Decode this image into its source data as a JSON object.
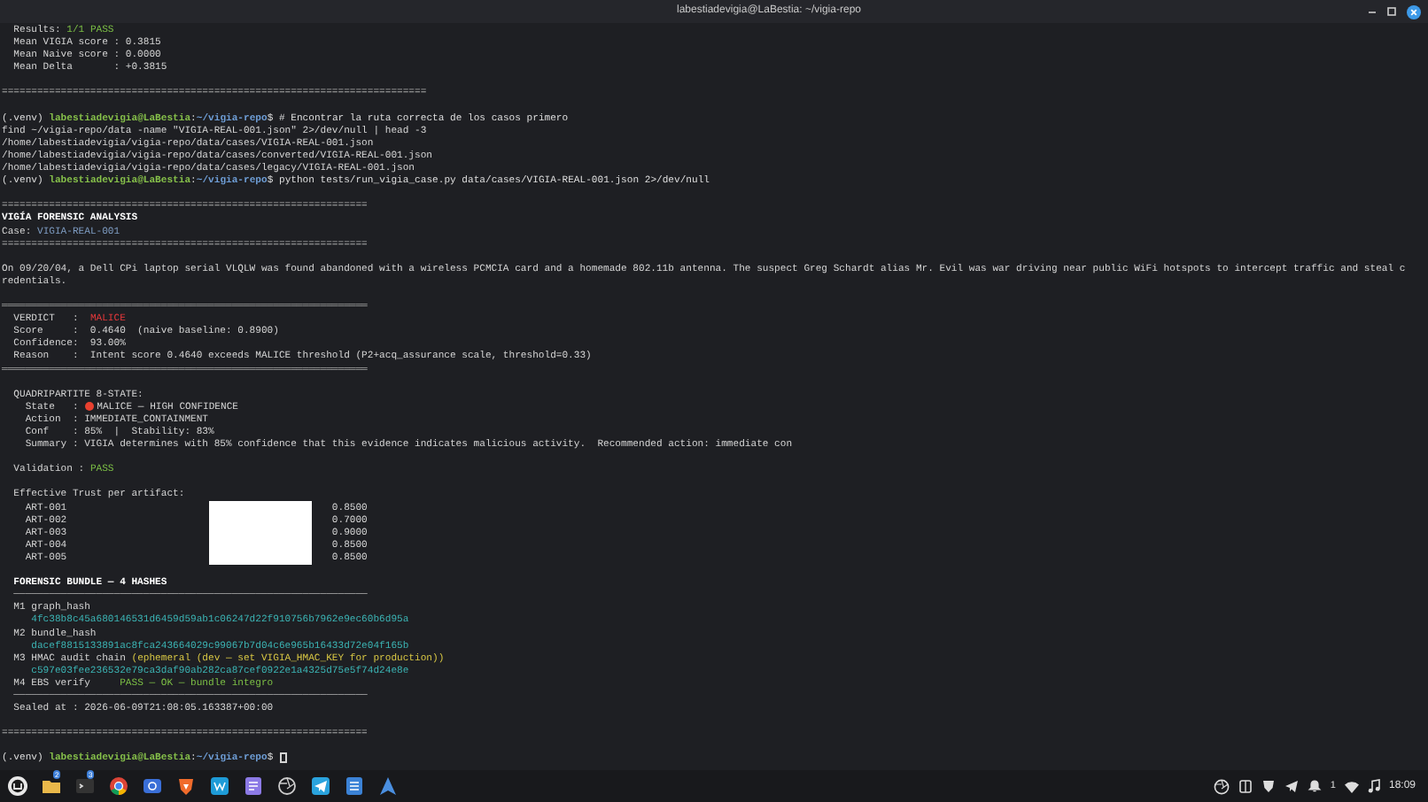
{
  "window": {
    "title": "labestiadevigia@LaBestia: ~/vigia-repo"
  },
  "terminal": {
    "lines": [
      {
        "kind": "output",
        "segments": [
          {
            "kind": "plain",
            "text": "  Results: "
          },
          {
            "kind": "pass",
            "text": "1/1 PASS"
          }
        ]
      },
      {
        "kind": "output",
        "segments": [
          {
            "kind": "plain",
            "text": "  Mean VIGIA score : 0.3815"
          }
        ]
      },
      {
        "kind": "output",
        "segments": [
          {
            "kind": "plain",
            "text": "  Mean Naive score : 0.0000"
          }
        ]
      },
      {
        "kind": "output",
        "segments": [
          {
            "kind": "plain",
            "text": "  Mean Delta       : +0.3815"
          }
        ]
      },
      {
        "kind": "rule",
        "space_before": true,
        "segments": [
          {
            "kind": "plain",
            "text": "========================================================================"
          }
        ]
      },
      {
        "kind": "prompt",
        "space_before": true,
        "segments": [
          {
            "kind": "plain",
            "text": "(.venv) "
          },
          {
            "kind": "user",
            "text": "labestiadevigia@LaBestia"
          },
          {
            "kind": "plain",
            "text": ":"
          },
          {
            "kind": "path",
            "text": "~/vigia-repo"
          },
          {
            "kind": "plain",
            "text": "$ # Encontrar la ruta correcta de los casos primero"
          }
        ]
      },
      {
        "kind": "output",
        "segments": [
          {
            "kind": "plain",
            "text": "find ~/vigia-repo/data -name \"VIGIA-REAL-001.json\" 2>/dev/null | head -3"
          }
        ]
      },
      {
        "kind": "output",
        "segments": [
          {
            "kind": "plain",
            "text": "/home/labestiadevigia/vigia-repo/data/cases/VIGIA-REAL-001.json"
          }
        ]
      },
      {
        "kind": "output",
        "segments": [
          {
            "kind": "plain",
            "text": "/home/labestiadevigia/vigia-repo/data/cases/converted/VIGIA-REAL-001.json"
          }
        ]
      },
      {
        "kind": "output",
        "segments": [
          {
            "kind": "plain",
            "text": "/home/labestiadevigia/vigia-repo/data/cases/legacy/VIGIA-REAL-001.json"
          }
        ]
      },
      {
        "kind": "prompt",
        "segments": [
          {
            "kind": "plain",
            "text": "(.venv) "
          },
          {
            "kind": "user",
            "text": "labestiadevigia@LaBestia"
          },
          {
            "kind": "plain",
            "text": ":"
          },
          {
            "kind": "path",
            "text": "~/vigia-repo"
          },
          {
            "kind": "plain",
            "text": "$ python tests/run_vigia_case.py data/cases/VIGIA-REAL-001.json 2>/dev/null"
          }
        ]
      },
      {
        "kind": "rule",
        "space_before": true,
        "segments": [
          {
            "kind": "plain",
            "text": "=============================================================="
          }
        ]
      },
      {
        "kind": "heading",
        "segments": [
          {
            "kind": "head",
            "text": "VIGÍA FORENSIC ANALYSIS"
          }
        ]
      },
      {
        "kind": "output",
        "segments": [
          {
            "kind": "plain",
            "text": "Case: "
          },
          {
            "kind": "case",
            "text": "VIGIA-REAL-001"
          }
        ]
      },
      {
        "kind": "rule",
        "segments": [
          {
            "kind": "plain",
            "text": "=============================================================="
          }
        ]
      },
      {
        "kind": "output",
        "space_before": true,
        "segments": [
          {
            "kind": "plain",
            "text": "On 09/20/04, a Dell CPi laptop serial VLQLW was found abandoned with a wireless PCMCIA card and a homemade 802.11b antenna. The suspect Greg Schardt alias Mr. Evil was war driving near public WiFi hotspots to intercept traffic and steal c"
          }
        ]
      },
      {
        "kind": "output",
        "segments": [
          {
            "kind": "plain",
            "text": "redentials."
          }
        ]
      },
      {
        "kind": "rule",
        "space_before": true,
        "segments": [
          {
            "kind": "plain",
            "text": "══════════════════════════════════════════════════════════════"
          }
        ]
      },
      {
        "kind": "output",
        "segments": [
          {
            "kind": "plain",
            "text": "  VERDICT   :  "
          },
          {
            "kind": "alert",
            "text": "MALICE"
          }
        ]
      },
      {
        "kind": "output",
        "segments": [
          {
            "kind": "plain",
            "text": "  Score     :  0.4640  (naive baseline: 0.8900)"
          }
        ]
      },
      {
        "kind": "output",
        "segments": [
          {
            "kind": "plain",
            "text": "  Confidence:  93.00%"
          }
        ]
      },
      {
        "kind": "output",
        "segments": [
          {
            "kind": "plain",
            "text": "  Reason    :  Intent score 0.4640 exceeds MALICE threshold (P2+acq_assurance scale, threshold=0.33)"
          }
        ]
      },
      {
        "kind": "rule",
        "segments": [
          {
            "kind": "plain",
            "text": "══════════════════════════════════════════════════════════════"
          }
        ]
      },
      {
        "kind": "output",
        "space_before": true,
        "segments": [
          {
            "kind": "plain",
            "text": "  QUADRIPARTITE 8-STATE:"
          }
        ]
      },
      {
        "kind": "output",
        "segments": [
          {
            "kind": "plain",
            "text": "    State   : "
          },
          {
            "kind": "dot"
          },
          {
            "kind": "plain",
            "text": "MALICE — HIGH CONFIDENCE"
          }
        ]
      },
      {
        "kind": "output",
        "segments": [
          {
            "kind": "plain",
            "text": "    Action  : IMMEDIATE_CONTAINMENT"
          }
        ]
      },
      {
        "kind": "output",
        "segments": [
          {
            "kind": "plain",
            "text": "    Conf    : 85%  |  Stability: 83%"
          }
        ]
      },
      {
        "kind": "output",
        "segments": [
          {
            "kind": "plain",
            "text": "    Summary : VIGIA determines with 85% confidence that this evidence indicates malicious activity.  Recommended action: immediate con"
          }
        ]
      },
      {
        "kind": "output",
        "space_before": true,
        "segments": [
          {
            "kind": "plain",
            "text": "  Validation : "
          },
          {
            "kind": "pass",
            "text": "PASS"
          }
        ]
      },
      {
        "kind": "output",
        "space_before": true,
        "segments": [
          {
            "kind": "plain",
            "text": "  Effective Trust per artifact:"
          }
        ]
      },
      {
        "kind": "output",
        "segments": [
          {
            "kind": "plain",
            "text": "    ART-001                                             0.8500"
          }
        ]
      },
      {
        "kind": "output",
        "segments": [
          {
            "kind": "plain",
            "text": "    ART-002                                             0.7000"
          }
        ]
      },
      {
        "kind": "output",
        "segments": [
          {
            "kind": "plain",
            "text": "    ART-003                                             0.9000"
          }
        ]
      },
      {
        "kind": "output",
        "segments": [
          {
            "kind": "plain",
            "text": "    ART-004                                             0.8500"
          }
        ]
      },
      {
        "kind": "output",
        "segments": [
          {
            "kind": "plain",
            "text": "    ART-005                                             0.8500"
          }
        ]
      },
      {
        "kind": "heading",
        "space_before": true,
        "segments": [
          {
            "kind": "head",
            "text": "  FORENSIC BUNDLE — 4 HASHES"
          }
        ]
      },
      {
        "kind": "rule",
        "segments": [
          {
            "kind": "plain",
            "text": "  ────────────────────────────────────────────────────────────"
          }
        ]
      },
      {
        "kind": "output",
        "segments": [
          {
            "kind": "plain",
            "text": "  M1 graph_hash"
          }
        ]
      },
      {
        "kind": "output",
        "segments": [
          {
            "kind": "hash",
            "text": "     4fc38b8c45a680146531d6459d59ab1c06247d22f910756b7962e9ec60b6d95a"
          }
        ]
      },
      {
        "kind": "output",
        "segments": [
          {
            "kind": "plain",
            "text": "  M2 bundle_hash"
          }
        ]
      },
      {
        "kind": "output",
        "segments": [
          {
            "kind": "hash",
            "text": "     dacef8815133891ac8fca243664029c99067b7d04c6e965b16433d72e04f165b"
          }
        ]
      },
      {
        "kind": "output",
        "segments": [
          {
            "kind": "plain",
            "text": "  M3 HMAC audit chain "
          },
          {
            "kind": "warn",
            "text": "(ephemeral (dev — set VIGIA_HMAC_KEY for production))"
          }
        ]
      },
      {
        "kind": "output",
        "segments": [
          {
            "kind": "hash",
            "text": "     c597e03fee236532e79ca3daf90ab282ca87cef0922e1a4325d75e5f74d24e8e"
          }
        ]
      },
      {
        "kind": "output",
        "segments": [
          {
            "kind": "plain",
            "text": "  M4 EBS verify     "
          },
          {
            "kind": "pass",
            "text": "PASS — OK — bundle integro"
          }
        ]
      },
      {
        "kind": "rule",
        "segments": [
          {
            "kind": "plain",
            "text": "  ────────────────────────────────────────────────────────────"
          }
        ]
      },
      {
        "kind": "output",
        "segments": [
          {
            "kind": "plain",
            "text": "  Sealed at : 2026-06-09T21:08:05.163387+00:00"
          }
        ]
      },
      {
        "kind": "rule",
        "space_before": true,
        "segments": [
          {
            "kind": "plain",
            "text": "=============================================================="
          }
        ]
      },
      {
        "kind": "prompt",
        "space_before": true,
        "cursor": true,
        "segments": [
          {
            "kind": "plain",
            "text": "(.venv) "
          },
          {
            "kind": "user",
            "text": "labestiadevigia@LaBestia"
          },
          {
            "kind": "plain",
            "text": ":"
          },
          {
            "kind": "path",
            "text": "~/vigia-repo"
          },
          {
            "kind": "plain",
            "text": "$ "
          }
        ]
      }
    ]
  },
  "taskbar": {
    "apps": [
      {
        "kind": "menu"
      },
      {
        "kind": "files",
        "badge": "2"
      },
      {
        "kind": "terminal",
        "badge": "3"
      },
      {
        "kind": "browser"
      },
      {
        "kind": "camera"
      },
      {
        "kind": "lion"
      },
      {
        "kind": "editor"
      },
      {
        "kind": "notes"
      },
      {
        "kind": "aperture"
      },
      {
        "kind": "telegram"
      },
      {
        "kind": "document"
      },
      {
        "kind": "arch"
      }
    ],
    "tray": {
      "notification_count": "1",
      "clock": "18:09"
    }
  }
}
